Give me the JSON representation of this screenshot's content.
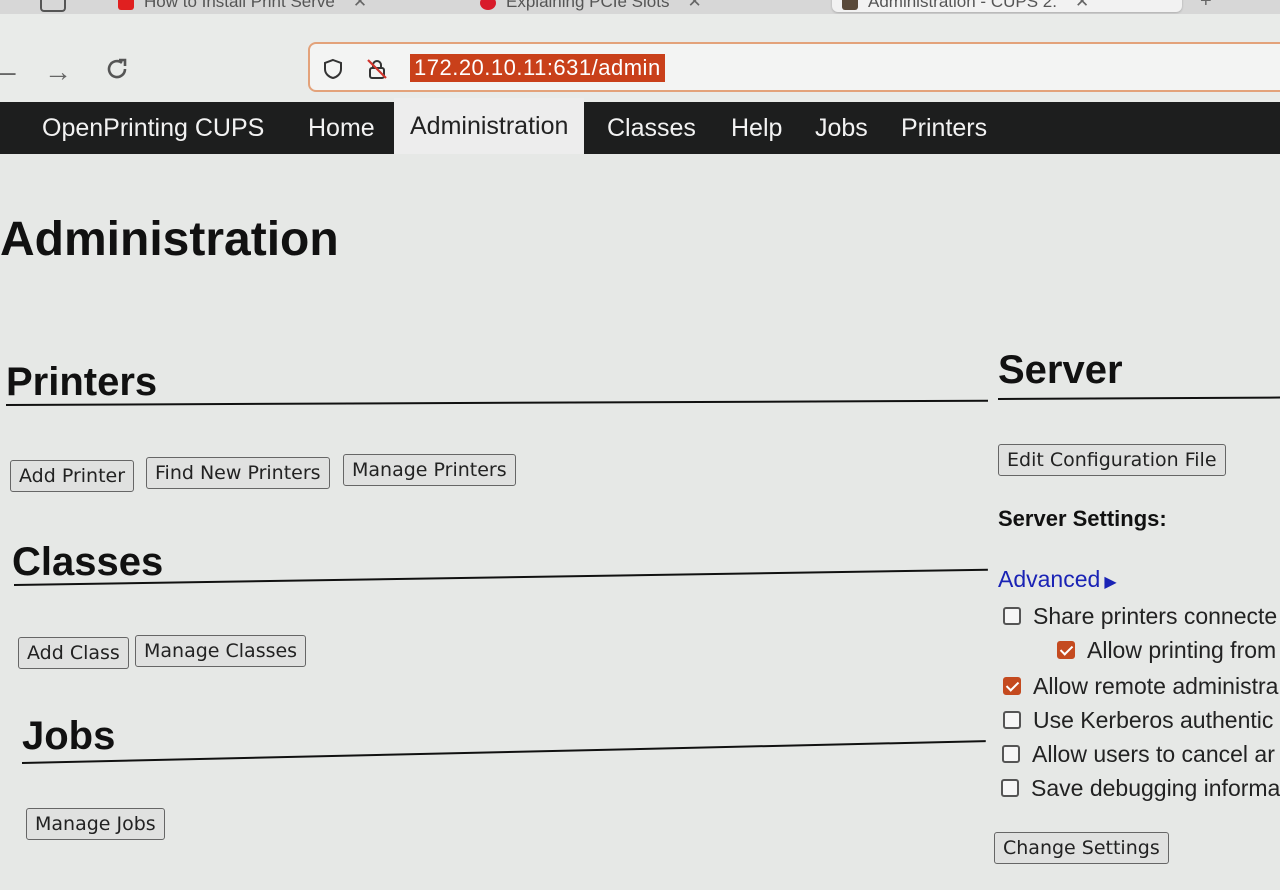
{
  "browser": {
    "tabs": [
      {
        "title": "How to Install Print Serve",
        "favicon_color": "#e02020"
      },
      {
        "title": "Explaining PCIe Slots",
        "favicon_color": "#d81b2a"
      },
      {
        "title": "Administration - CUPS 2.",
        "favicon_color": "#5a4a3a",
        "active": true
      }
    ],
    "url": "172.20.10.11:631/admin"
  },
  "cups_nav": {
    "items": [
      "OpenPrinting CUPS",
      "Home",
      "Administration",
      "Classes",
      "Help",
      "Jobs",
      "Printers"
    ],
    "active": "Administration"
  },
  "page": {
    "title": "Administration",
    "printers": {
      "heading": "Printers",
      "buttons": [
        "Add Printer",
        "Find New Printers",
        "Manage Printers"
      ]
    },
    "classes": {
      "heading": "Classes",
      "buttons": [
        "Add Class",
        "Manage Classes"
      ]
    },
    "jobs": {
      "heading": "Jobs",
      "buttons": [
        "Manage Jobs"
      ]
    },
    "server": {
      "heading": "Server",
      "edit_button": "Edit Configuration File",
      "settings_label": "Server Settings:",
      "advanced_link": "Advanced",
      "settings": [
        {
          "label": "Share printers connecte",
          "checked": false
        },
        {
          "label": "Allow printing from",
          "checked": true
        },
        {
          "label": "Allow remote administra",
          "checked": true
        },
        {
          "label": "Use Kerberos authentic",
          "checked": false
        },
        {
          "label": "Allow users to cancel ar",
          "checked": false
        },
        {
          "label": "Save debugging informa",
          "checked": false
        }
      ],
      "change_button": "Change Settings"
    }
  },
  "colors": {
    "accent": "#c44a1f",
    "header_bg": "#1d1e1e",
    "link": "#1a23b5"
  }
}
